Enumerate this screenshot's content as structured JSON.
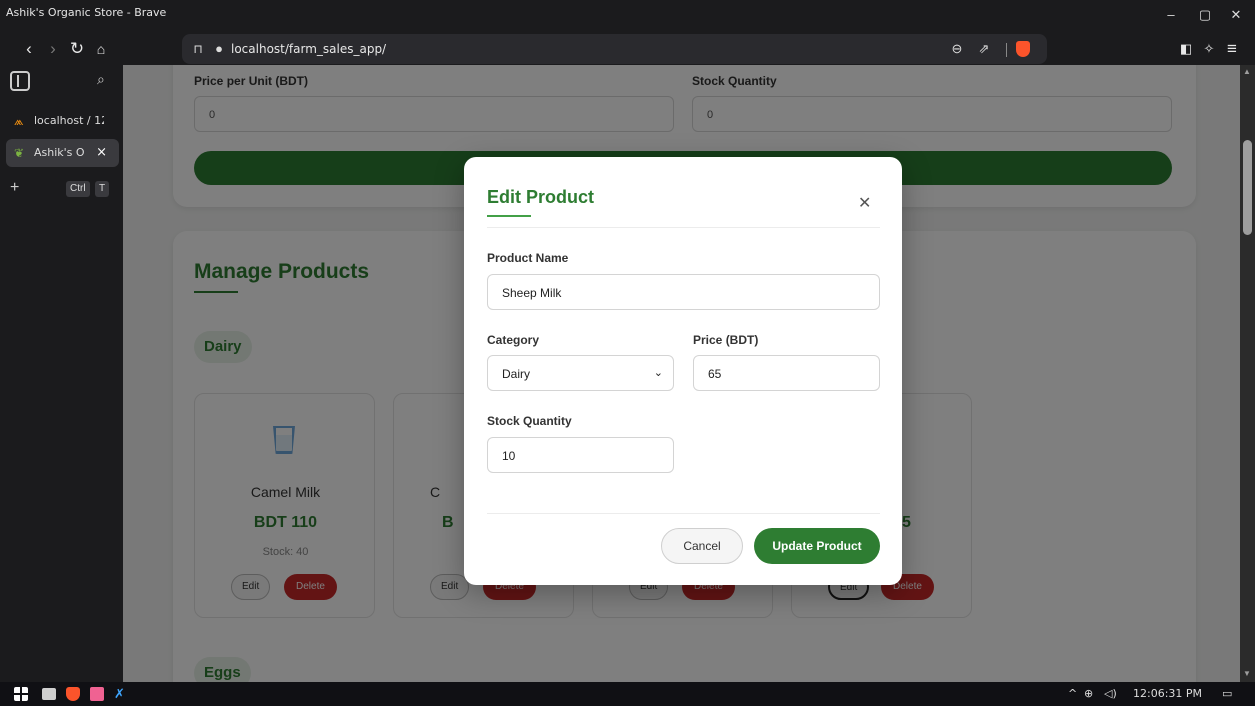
{
  "window": {
    "title": "Ashik's Organic Store - Brave",
    "minimize": "–",
    "restore": "▢",
    "close": "✕"
  },
  "address_bar": {
    "url": "localhost/farm_sales_app/"
  },
  "sidebar": {
    "tabs": [
      {
        "label": "localhost / 12",
        "active": false
      },
      {
        "label": "Ashik's O",
        "active": true
      }
    ],
    "new_tab_shortcut": [
      "Ctrl",
      "T"
    ]
  },
  "add_form": {
    "price_label": "Price per Unit (BDT)",
    "price_value": "0",
    "stock_label": "Stock Quantity",
    "stock_value": "0"
  },
  "manage": {
    "title": "Manage Products",
    "categories": [
      "Dairy",
      "Eggs"
    ],
    "products": [
      {
        "name": "Camel Milk",
        "price": "BDT 110",
        "stock": "Stock: 40",
        "edit": "Edit",
        "delete": "Delete"
      },
      {
        "name": "C",
        "price": "B",
        "stock": "",
        "edit": "Edit",
        "delete": "Delete"
      },
      {
        "name": "",
        "price": "",
        "stock": "",
        "edit": "Edit",
        "delete": "Delete"
      },
      {
        "name": "ilk",
        "price": "5",
        "stock": "",
        "edit": "Edit",
        "delete": "Delete"
      }
    ]
  },
  "modal": {
    "title": "Edit Product",
    "product_name_label": "Product Name",
    "product_name_value": "Sheep Milk",
    "category_label": "Category",
    "category_value": "Dairy",
    "price_label": "Price (BDT)",
    "price_value": "65",
    "stock_label": "Stock Quantity",
    "stock_value": "10",
    "cancel_label": "Cancel",
    "update_label": "Update Product"
  },
  "taskbar": {
    "time": "12:06:31 PM"
  },
  "colors": {
    "primary_green": "#2e7d32",
    "danger_red": "#c62828",
    "brave_orange": "#fb542b"
  }
}
